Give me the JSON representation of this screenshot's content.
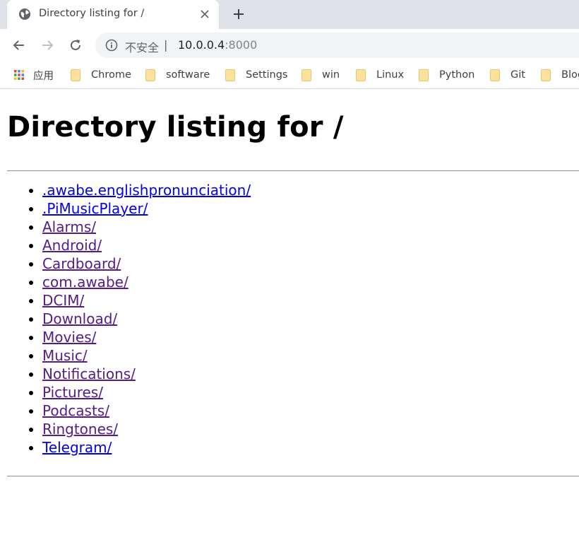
{
  "browser": {
    "tab": {
      "title": "Directory listing for /"
    },
    "omnibox": {
      "security_label": "不安全",
      "separator": "|",
      "url_host": "10.0.0.4",
      "url_port": ":8000"
    },
    "bookmarks": {
      "apps_label": "应用",
      "items": [
        {
          "label": "Chrome"
        },
        {
          "label": "software"
        },
        {
          "label": "Settings"
        },
        {
          "label": "win"
        },
        {
          "label": "Linux"
        },
        {
          "label": "Python"
        },
        {
          "label": "Git"
        },
        {
          "label": "Blog"
        }
      ]
    }
  },
  "page": {
    "heading": "Directory listing for /",
    "entries": [
      {
        "name": ".awabe.englishpronunciation/",
        "visited": false
      },
      {
        "name": ".PiMusicPlayer/",
        "visited": false
      },
      {
        "name": "Alarms/",
        "visited": true
      },
      {
        "name": "Android/",
        "visited": true
      },
      {
        "name": "Cardboard/",
        "visited": true
      },
      {
        "name": "com.awabe/",
        "visited": true
      },
      {
        "name": "DCIM/",
        "visited": true
      },
      {
        "name": "Download/",
        "visited": true
      },
      {
        "name": "Movies/",
        "visited": true
      },
      {
        "name": "Music/",
        "visited": true
      },
      {
        "name": "Notifications/",
        "visited": true
      },
      {
        "name": "Pictures/",
        "visited": true
      },
      {
        "name": "Podcasts/",
        "visited": true
      },
      {
        "name": "Ringtones/",
        "visited": true
      },
      {
        "name": "Telegram/",
        "visited": false
      }
    ]
  },
  "colors": {
    "tabstrip": "#dee1e6",
    "omnibox": "#f1f3f4",
    "link": "#0000ee",
    "visited_link": "#551a8b",
    "folder": "#fbe19b"
  }
}
